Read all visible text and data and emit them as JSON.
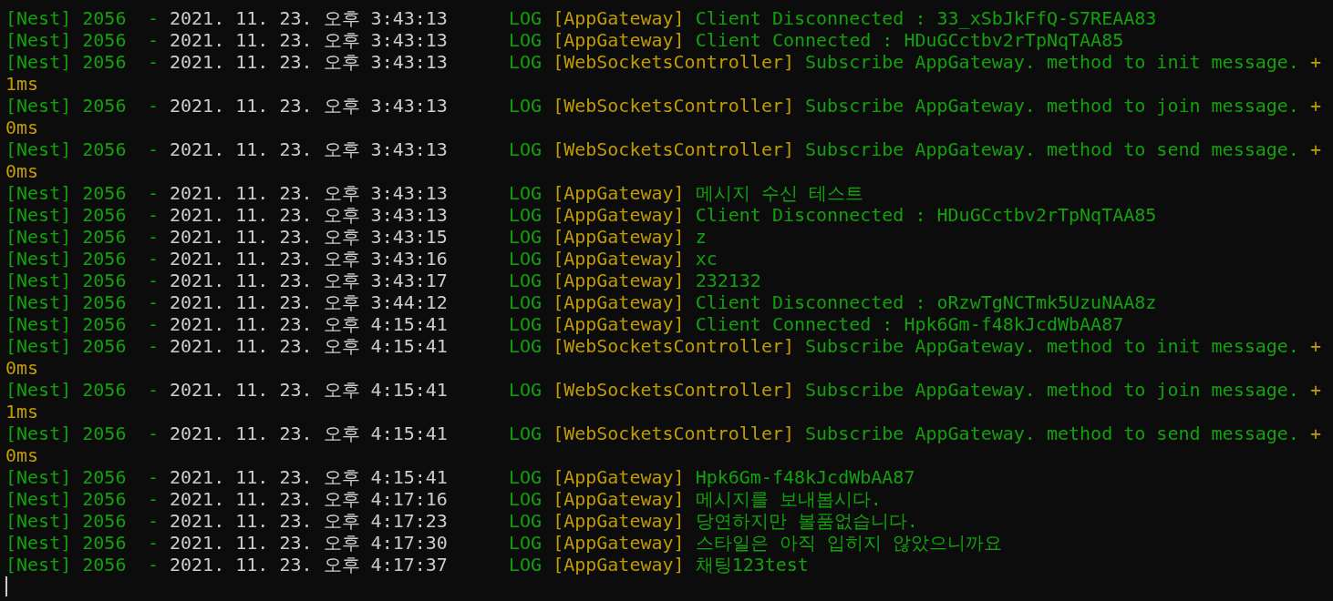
{
  "log_lines": [
    {
      "process": "[Nest] 2056",
      "separator": "-",
      "timestamp": "2021. 11. 23. 오후 3:43:13",
      "level": "LOG",
      "context": "[AppGateway]",
      "message": "Client Disconnected : 33_xSbJkFfQ-S7REAA83"
    },
    {
      "process": "[Nest] 2056",
      "separator": "-",
      "timestamp": "2021. 11. 23. 오후 3:43:13",
      "level": "LOG",
      "context": "[AppGateway]",
      "message": "Client Connected : HDuGCctbv2rTpNqTAA85"
    },
    {
      "process": "[Nest] 2056",
      "separator": "-",
      "timestamp": "2021. 11. 23. 오후 3:43:13",
      "level": "LOG",
      "context": "[WebSocketsController]",
      "message": "Subscribe AppGateway. method to init message.",
      "plus": "+",
      "elapsed": "1ms"
    },
    {
      "process": "[Nest] 2056",
      "separator": "-",
      "timestamp": "2021. 11. 23. 오후 3:43:13",
      "level": "LOG",
      "context": "[WebSocketsController]",
      "message": "Subscribe AppGateway. method to join message.",
      "plus": "+",
      "elapsed": "0ms"
    },
    {
      "process": "[Nest] 2056",
      "separator": "-",
      "timestamp": "2021. 11. 23. 오후 3:43:13",
      "level": "LOG",
      "context": "[WebSocketsController]",
      "message": "Subscribe AppGateway. method to send message.",
      "plus": "+",
      "elapsed": "0ms"
    },
    {
      "process": "[Nest] 2056",
      "separator": "-",
      "timestamp": "2021. 11. 23. 오후 3:43:13",
      "level": "LOG",
      "context": "[AppGateway]",
      "message": "메시지 수신 테스트"
    },
    {
      "process": "[Nest] 2056",
      "separator": "-",
      "timestamp": "2021. 11. 23. 오후 3:43:13",
      "level": "LOG",
      "context": "[AppGateway]",
      "message": "Client Disconnected : HDuGCctbv2rTpNqTAA85"
    },
    {
      "process": "[Nest] 2056",
      "separator": "-",
      "timestamp": "2021. 11. 23. 오후 3:43:15",
      "level": "LOG",
      "context": "[AppGateway]",
      "message": "z"
    },
    {
      "process": "[Nest] 2056",
      "separator": "-",
      "timestamp": "2021. 11. 23. 오후 3:43:16",
      "level": "LOG",
      "context": "[AppGateway]",
      "message": "xc"
    },
    {
      "process": "[Nest] 2056",
      "separator": "-",
      "timestamp": "2021. 11. 23. 오후 3:43:17",
      "level": "LOG",
      "context": "[AppGateway]",
      "message": "232132"
    },
    {
      "process": "[Nest] 2056",
      "separator": "-",
      "timestamp": "2021. 11. 23. 오후 3:44:12",
      "level": "LOG",
      "context": "[AppGateway]",
      "message": "Client Disconnected : oRzwTgNCTmk5UzuNAA8z"
    },
    {
      "process": "[Nest] 2056",
      "separator": "-",
      "timestamp": "2021. 11. 23. 오후 4:15:41",
      "level": "LOG",
      "context": "[AppGateway]",
      "message": "Client Connected : Hpk6Gm-f48kJcdWbAA87"
    },
    {
      "process": "[Nest] 2056",
      "separator": "-",
      "timestamp": "2021. 11. 23. 오후 4:15:41",
      "level": "LOG",
      "context": "[WebSocketsController]",
      "message": "Subscribe AppGateway. method to init message.",
      "plus": "+",
      "elapsed": "0ms"
    },
    {
      "process": "[Nest] 2056",
      "separator": "-",
      "timestamp": "2021. 11. 23. 오후 4:15:41",
      "level": "LOG",
      "context": "[WebSocketsController]",
      "message": "Subscribe AppGateway. method to join message.",
      "plus": "+",
      "elapsed": "1ms"
    },
    {
      "process": "[Nest] 2056",
      "separator": "-",
      "timestamp": "2021. 11. 23. 오후 4:15:41",
      "level": "LOG",
      "context": "[WebSocketsController]",
      "message": "Subscribe AppGateway. method to send message.",
      "plus": "+",
      "elapsed": "0ms"
    },
    {
      "process": "[Nest] 2056",
      "separator": "-",
      "timestamp": "2021. 11. 23. 오후 4:15:41",
      "level": "LOG",
      "context": "[AppGateway]",
      "message": "Hpk6Gm-f48kJcdWbAA87"
    },
    {
      "process": "[Nest] 2056",
      "separator": "-",
      "timestamp": "2021. 11. 23. 오후 4:17:16",
      "level": "LOG",
      "context": "[AppGateway]",
      "message": "메시지를 보내봅시다."
    },
    {
      "process": "[Nest] 2056",
      "separator": "-",
      "timestamp": "2021. 11. 23. 오후 4:17:23",
      "level": "LOG",
      "context": "[AppGateway]",
      "message": "당연하지만 볼품없습니다."
    },
    {
      "process": "[Nest] 2056",
      "separator": "-",
      "timestamp": "2021. 11. 23. 오후 4:17:30",
      "level": "LOG",
      "context": "[AppGateway]",
      "message": "스타일은 아직 입히지 않았으니까요"
    },
    {
      "process": "[Nest] 2056",
      "separator": "-",
      "timestamp": "2021. 11. 23. 오후 4:17:37",
      "level": "LOG",
      "context": "[AppGateway]",
      "message": "채팅123test"
    }
  ]
}
